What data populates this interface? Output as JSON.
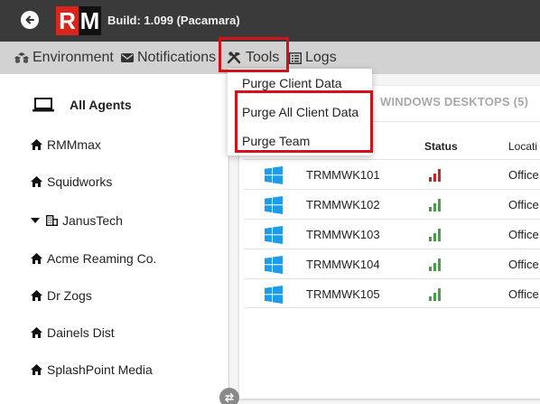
{
  "header": {
    "logo_r": "R",
    "logo_m": "M",
    "build": "Build: 1.099 (Pacamara)"
  },
  "menu": {
    "environment": "Environment",
    "notifications": "Notifications",
    "tools": "Tools",
    "logs": "Logs"
  },
  "tools_menu": {
    "items": [
      "Purge Client Data",
      "Purge All Client Data",
      "Purge Team"
    ]
  },
  "sidebar": {
    "all_agents": "All Agents",
    "items": [
      "RMMmax",
      "Squidworks",
      "JanusTech",
      "Acme Reaming Co.",
      "Dr Zogs",
      "Dainels Dist",
      "SplashPoint Media"
    ]
  },
  "main": {
    "tab": "WINDOWS DESKTOPS (5)",
    "columns": {
      "status": "Status",
      "location": "Locati"
    },
    "rows": [
      {
        "name": "TRMMWK101",
        "status": "red",
        "location": "Office"
      },
      {
        "name": "TRMMWK102",
        "status": "green",
        "location": "Office"
      },
      {
        "name": "TRMMWK103",
        "status": "green",
        "location": "Office"
      },
      {
        "name": "TRMMWK104",
        "status": "green",
        "location": "Office"
      },
      {
        "name": "TRMMWK105",
        "status": "green",
        "location": "Office"
      }
    ]
  },
  "colors": {
    "accent_red": "#d0121b",
    "status_red": "#c62828",
    "status_green": "#43a047",
    "windows_blue": "#1e9be9"
  }
}
